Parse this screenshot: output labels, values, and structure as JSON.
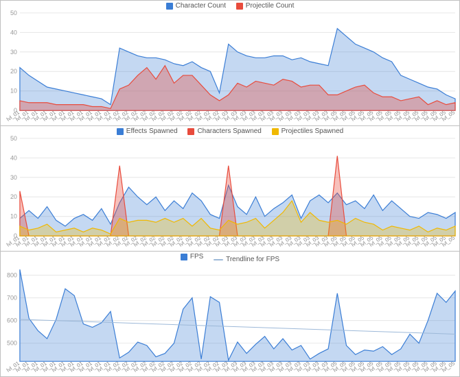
{
  "chart_data": [
    {
      "type": "area",
      "title": "",
      "ylim": [
        0,
        50
      ],
      "yticks": [
        0,
        10,
        20,
        30,
        40,
        50
      ],
      "categories": [
        "lvl_01",
        "lvl_01",
        "lvl_01",
        "lvl_01",
        "lvl_01",
        "lvl_01",
        "lvl_01",
        "lvl_01",
        "lvl_01",
        "lvl_01",
        "lvl_01",
        "lvl_02",
        "lvl_02",
        "lvl_02",
        "lvl_02",
        "lvl_02",
        "lvl_02",
        "lvl_02",
        "lvl_02",
        "lvl_02",
        "lvl_02",
        "lvl_02",
        "lvl_02",
        "lvl_03",
        "lvl_03",
        "lvl_03",
        "lvl_03",
        "lvl_03",
        "lvl_03",
        "lvl_03",
        "lvl_03",
        "lvl_03",
        "lvl_03",
        "lvl_03",
        "lvl_03",
        "lvl_05",
        "lvl_05",
        "lvl_05",
        "lvl_05",
        "lvl_05",
        "lvl_05",
        "lvl_05",
        "lvl_05",
        "lvl_05",
        "lvl_05",
        "lvl_05",
        "lvl_05",
        "lvl_05",
        "lvl_05"
      ],
      "series": [
        {
          "name": "Character Count",
          "color": "blue",
          "values": [
            22,
            18,
            15,
            12,
            11,
            10,
            9,
            8,
            7,
            6,
            3,
            32,
            30,
            28,
            27,
            27,
            26,
            24,
            23,
            25,
            22,
            20,
            9,
            34,
            30,
            28,
            27,
            27,
            28,
            28,
            26,
            27,
            25,
            24,
            23,
            42,
            38,
            34,
            32,
            30,
            27,
            25,
            18,
            16,
            14,
            12,
            11,
            8,
            6
          ]
        },
        {
          "name": "Projectile Count",
          "color": "red",
          "values": [
            5,
            4,
            4,
            4,
            3,
            3,
            3,
            3,
            2,
            2,
            1,
            11,
            13,
            18,
            22,
            16,
            23,
            14,
            18,
            18,
            13,
            8,
            5,
            8,
            14,
            12,
            15,
            14,
            13,
            16,
            15,
            12,
            13,
            13,
            8,
            8,
            10,
            12,
            13,
            9,
            7,
            7,
            5,
            6,
            7,
            3,
            5,
            3,
            4
          ]
        }
      ]
    },
    {
      "type": "area",
      "title": "",
      "ylim": [
        0,
        50
      ],
      "yticks": [
        0,
        10,
        20,
        30,
        40,
        50
      ],
      "categories": [
        "lvl_01",
        "lvl_01",
        "lvl_01",
        "lvl_01",
        "lvl_01",
        "lvl_01",
        "lvl_01",
        "lvl_01",
        "lvl_01",
        "lvl_01",
        "lvl_01",
        "lvl_02",
        "lvl_02",
        "lvl_02",
        "lvl_02",
        "lvl_02",
        "lvl_02",
        "lvl_02",
        "lvl_02",
        "lvl_02",
        "lvl_02",
        "lvl_02",
        "lvl_02",
        "lvl_03",
        "lvl_03",
        "lvl_03",
        "lvl_03",
        "lvl_03",
        "lvl_03",
        "lvl_03",
        "lvl_03",
        "lvl_03",
        "lvl_03",
        "lvl_03",
        "lvl_03",
        "lvl_05",
        "lvl_05",
        "lvl_05",
        "lvl_05",
        "lvl_05",
        "lvl_05",
        "lvl_05",
        "lvl_05",
        "lvl_05",
        "lvl_05",
        "lvl_05",
        "lvl_05",
        "lvl_05",
        "lvl_05"
      ],
      "series": [
        {
          "name": "Effects Spawned",
          "color": "blue",
          "values": [
            9,
            13,
            9,
            15,
            8,
            5,
            9,
            11,
            8,
            14,
            6,
            17,
            25,
            20,
            16,
            20,
            13,
            18,
            14,
            22,
            18,
            11,
            9,
            26,
            15,
            11,
            20,
            10,
            14,
            17,
            21,
            9,
            18,
            21,
            17,
            22,
            16,
            18,
            14,
            21,
            13,
            18,
            14,
            10,
            9,
            12,
            11,
            9,
            12
          ]
        },
        {
          "name": "Characters Spawned",
          "color": "red",
          "values": [
            23,
            0,
            0,
            0,
            0,
            0,
            0,
            0,
            0,
            0,
            0,
            36,
            0,
            0,
            0,
            0,
            0,
            0,
            0,
            0,
            0,
            0,
            0,
            36,
            0,
            0,
            0,
            0,
            0,
            0,
            0,
            0,
            0,
            0,
            0,
            41,
            0,
            0,
            0,
            0,
            0,
            0,
            0,
            0,
            0,
            0,
            0,
            0,
            0
          ]
        },
        {
          "name": "Projectiles Spawned",
          "color": "yellow",
          "values": [
            5,
            3,
            4,
            6,
            2,
            3,
            4,
            2,
            4,
            3,
            1,
            9,
            7,
            8,
            8,
            7,
            9,
            7,
            9,
            5,
            9,
            4,
            3,
            8,
            6,
            7,
            9,
            4,
            8,
            12,
            18,
            7,
            12,
            8,
            7,
            8,
            6,
            9,
            7,
            6,
            3,
            5,
            4,
            3,
            5,
            2,
            4,
            3,
            5
          ]
        }
      ]
    },
    {
      "type": "area",
      "title": "",
      "ylim": [
        420,
        850
      ],
      "yticks": [
        500,
        600,
        700,
        800
      ],
      "categories": [
        "lvl_01",
        "lvl_01",
        "lvl_01",
        "lvl_01",
        "lvl_01",
        "lvl_01",
        "lvl_01",
        "lvl_01",
        "lvl_01",
        "lvl_01",
        "lvl_01",
        "lvl_02",
        "lvl_02",
        "lvl_02",
        "lvl_02",
        "lvl_02",
        "lvl_02",
        "lvl_02",
        "lvl_02",
        "lvl_02",
        "lvl_02",
        "lvl_02",
        "lvl_02",
        "lvl_03",
        "lvl_03",
        "lvl_03",
        "lvl_03",
        "lvl_03",
        "lvl_03",
        "lvl_03",
        "lvl_03",
        "lvl_03",
        "lvl_03",
        "lvl_03",
        "lvl_03",
        "lvl_05",
        "lvl_05",
        "lvl_05",
        "lvl_05",
        "lvl_05",
        "lvl_05",
        "lvl_05",
        "lvl_05",
        "lvl_05",
        "lvl_05",
        "lvl_05",
        "lvl_05",
        "lvl_05",
        "lvl_05"
      ],
      "series": [
        {
          "name": "FPS",
          "color": "blue",
          "values": [
            825,
            610,
            555,
            520,
            605,
            740,
            710,
            585,
            570,
            590,
            640,
            435,
            460,
            505,
            490,
            440,
            455,
            500,
            650,
            700,
            430,
            705,
            680,
            425,
            505,
            455,
            495,
            530,
            475,
            520,
            470,
            490,
            430,
            455,
            475,
            720,
            490,
            450,
            470,
            465,
            485,
            450,
            475,
            540,
            500,
            600,
            720,
            680,
            730
          ]
        }
      ],
      "trendline": {
        "label": "Trendline for FPS",
        "start": 605,
        "end": 540
      }
    }
  ],
  "legends": [
    [
      {
        "color": "blue",
        "path": "chart_data.0.series.0.name"
      },
      {
        "color": "red",
        "path": "chart_data.0.series.1.name"
      }
    ],
    [
      {
        "color": "blue",
        "path": "chart_data.1.series.0.name"
      },
      {
        "color": "red",
        "path": "chart_data.1.series.1.name"
      },
      {
        "color": "yellow",
        "path": "chart_data.1.series.2.name"
      }
    ],
    [
      {
        "color": "blue",
        "path": "chart_data.2.series.0.name"
      },
      {
        "color": "line",
        "path": "chart_data.2.trendline.label"
      }
    ]
  ]
}
